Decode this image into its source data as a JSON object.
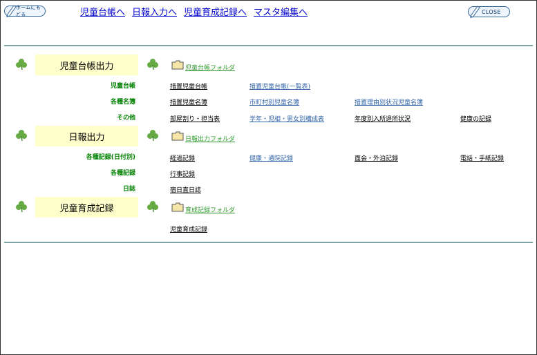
{
  "header": {
    "home_label": "ホームにもどる",
    "close_label": "CLOSE",
    "nav": [
      "児童台帳へ",
      "日報入力へ",
      "児童育成記録へ",
      "マスタ編集へ"
    ]
  },
  "sections": {
    "daicho": {
      "title": "児童台帳出力",
      "folder": "児童台帳フォルダ",
      "rows": [
        {
          "category": "児童台帳",
          "links": [
            "措置児童台帳",
            "措置児童台帳(一覧表)"
          ]
        },
        {
          "category": "各種名簿",
          "links": [
            "措置児童名簿",
            "市町村別児童名簿",
            "措置理由別状況児童名簿"
          ]
        },
        {
          "category": "その他",
          "links": [
            "部屋割り・担当表",
            "学年・児相・男女別構成表",
            "年度別入所退所状況",
            "健康の記録"
          ]
        }
      ]
    },
    "nippo": {
      "title": "日報出力",
      "folder": "日報出力フォルダ",
      "rows": [
        {
          "category": "各種記録(日付別)",
          "links": [
            "経過記録",
            "健康・通院記録",
            "面会・外泊記録",
            "電話・手紙記録"
          ]
        },
        {
          "category": "各種記録",
          "links": [
            "行事記録"
          ]
        },
        {
          "category": "日誌",
          "links": [
            "宿日直日誌"
          ]
        }
      ]
    },
    "ikusei": {
      "title": "児童育成記録",
      "folder": "育成記録フォルダ",
      "links": [
        "児童育成記録"
      ]
    }
  }
}
